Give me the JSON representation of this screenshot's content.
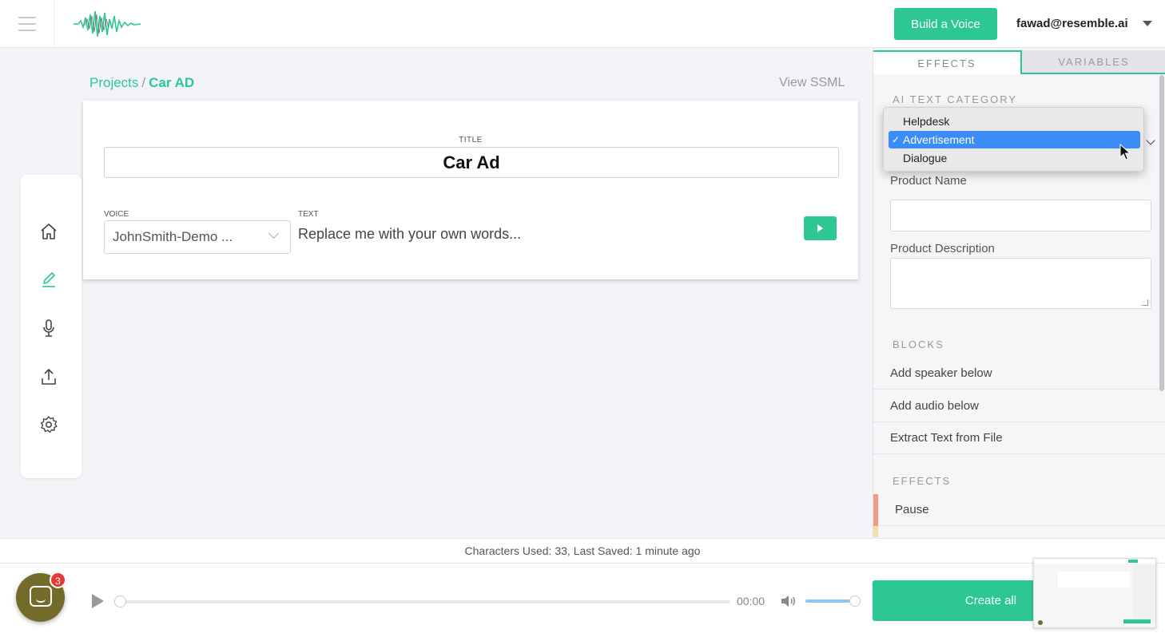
{
  "header": {
    "build_voice_label": "Build a Voice",
    "user_email": "fawad@resemble.ai"
  },
  "breadcrumb": {
    "root": "Projects",
    "separator": "/",
    "current": "Car AD"
  },
  "view_ssml_label": "View SSML",
  "editor": {
    "title_label": "TITLE",
    "title_value": "Car Ad",
    "voice_label": "VOICE",
    "voice_value": "JohnSmith-Demo ...",
    "text_label": "TEXT",
    "text_value": "Replace me with your own words..."
  },
  "right_panel": {
    "tabs": [
      {
        "label": "EFFECTS",
        "active": true
      },
      {
        "label": "VARIABLES",
        "active": false
      }
    ],
    "ai_text_category_label": "AI TEXT CATEGORY",
    "dropdown": {
      "options": [
        {
          "label": "Helpdesk",
          "selected": false
        },
        {
          "label": "Advertisement",
          "selected": true
        },
        {
          "label": "Dialogue",
          "selected": false
        }
      ],
      "check_glyph": "✓"
    },
    "product_name_label": "Product Name",
    "product_name_value": "",
    "product_description_label": "Product Description",
    "product_description_value": "",
    "blocks_label": "BLOCKS",
    "blocks": [
      "Add speaker below",
      "Add audio below",
      "Extract Text from File"
    ],
    "effects_label": "EFFECTS",
    "effects": [
      {
        "label": "Pause",
        "color": "#f29a8a"
      }
    ]
  },
  "status": {
    "text": "Characters Used: 33, Last Saved: 1 minute ago"
  },
  "player": {
    "time": "00:00",
    "progress": 0,
    "volume": 1.0,
    "create_all_label": "Create all"
  },
  "chat": {
    "badge_count": "3"
  },
  "colors": {
    "accent": "#2cc795",
    "selection_blue": "#3b8cf5",
    "badge_red": "#e53935",
    "chat_bubble": "#746a2a"
  },
  "icons": {
    "nav": [
      "home-icon",
      "edit-icon",
      "microphone-icon",
      "upload-icon",
      "gear-icon"
    ]
  }
}
